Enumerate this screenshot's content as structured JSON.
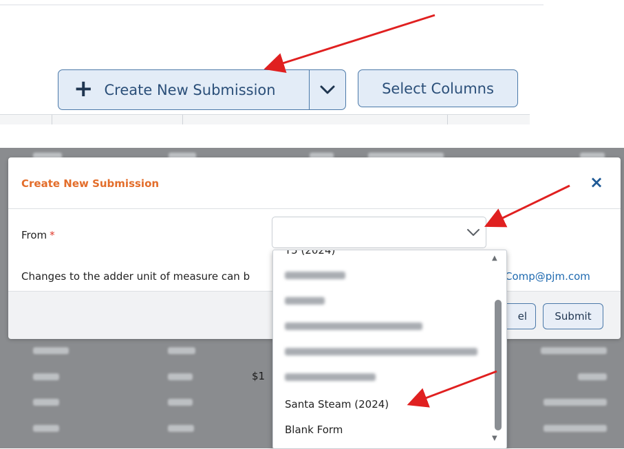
{
  "toolbar": {
    "create_label": "Create New Submission",
    "select_columns_label": "Select Columns"
  },
  "modal": {
    "title": "Create New Submission",
    "close_label": "×",
    "from_label": "From",
    "required_mark": "*",
    "note_text": "Changes to the adder unit of measure can b",
    "email_text": "Comp@pjm.com",
    "cancel_label": "el",
    "submit_label": "Submit"
  },
  "dropdown": {
    "partial_top_option": "T5 (2024)",
    "options": [
      "Santa Steam (2024)",
      "Blank Form"
    ],
    "blurred_option_count": 6
  },
  "background_table": {
    "visible_value": "$1"
  },
  "colors": {
    "button_fill": "#e3ecf7",
    "button_border": "#4a78a8",
    "modal_title": "#e36d2a",
    "close_icon": "#1f5a96",
    "required": "#e0392b",
    "link": "#1f6ab0",
    "annotation_arrow": "#e02020"
  },
  "icons": [
    "plus-icon",
    "chevron-down-icon",
    "close-icon",
    "scroll-up-icon",
    "scroll-down-icon",
    "red-arrow-annotation"
  ]
}
